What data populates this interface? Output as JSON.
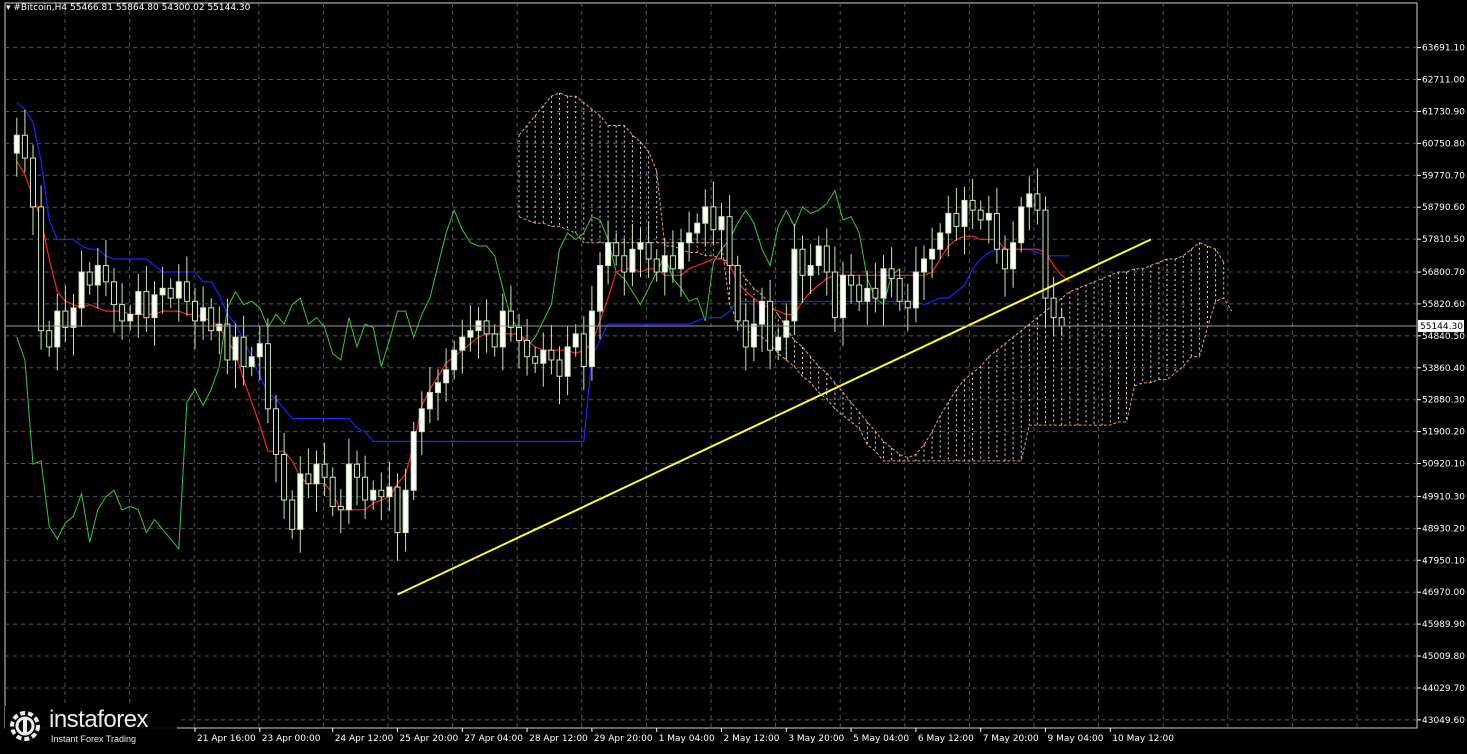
{
  "header": {
    "symbol_text": "#Bitcoin,H4  55466.81 55864.80 54300.02 55144.30"
  },
  "watermark": {
    "name": "instaforex",
    "tagline": "Instant Forex Trading",
    "icon": "instaforex-gear-icon"
  },
  "colors": {
    "background": "#000000",
    "grid": "#4a5a5a",
    "bull_candle": "#ffffff",
    "bear_candle": "#000000",
    "candle_wick": "#cce8b0",
    "tenkan": "#ff2020",
    "kijun": "#2020ff",
    "chikou": "#33cc33",
    "cloud_bull": "#e0e0e0",
    "cloud_bear": "#e8a070",
    "trendline": "#ffff33",
    "axis_text": "#ffffff"
  },
  "chart_data": {
    "type": "candlestick",
    "instrument": "#Bitcoin",
    "timeframe": "H4",
    "ohlc_header": {
      "open": 55466.81,
      "high": 55864.8,
      "low": 54300.02,
      "close": 55144.3
    },
    "current_price": 55144.3,
    "current_price_label": "55144.30",
    "ylim": [
      42800,
      64600
    ],
    "y_ticks": [
      "63691.10",
      "62711.00",
      "61730.90",
      "60750.80",
      "59770.70",
      "58790.60",
      "57810.50",
      "56800.70",
      "55820.60",
      "54840.50",
      "53860.40",
      "52880.30",
      "51900.20",
      "50920.10",
      "49910.30",
      "48930.20",
      "47950.10",
      "46970.00",
      "45989.90",
      "45009.80",
      "44029.70",
      "43049.60"
    ],
    "x_ticks": [
      {
        "label": "21 Apr 16:00",
        "index": 0
      },
      {
        "label": "23 Apr 00:00",
        "index": 8
      },
      {
        "label": "24 Apr 12:00",
        "index": 17
      },
      {
        "label": "25 Apr 20:00",
        "index": 25
      },
      {
        "label": "27 Apr 04:00",
        "index": 33
      },
      {
        "label": "28 Apr 12:00",
        "index": 41
      },
      {
        "label": "29 Apr 20:00",
        "index": 49
      },
      {
        "label": "1 May 04:00",
        "index": 57
      },
      {
        "label": "2 May 12:00",
        "index": 65
      },
      {
        "label": "3 May 20:00",
        "index": 73
      },
      {
        "label": "5 May 04:00",
        "index": 81
      },
      {
        "label": "6 May 12:00",
        "index": 89
      },
      {
        "label": "7 May 20:00",
        "index": 97
      },
      {
        "label": "9 May 04:00",
        "index": 105
      },
      {
        "label": "10 May 12:00",
        "index": 113
      }
    ],
    "candles_close": [
      60450,
      61000,
      60300,
      58800,
      55000,
      54500,
      55600,
      55100,
      55700,
      56800,
      56400,
      57000,
      56500,
      55800,
      55300,
      55500,
      56200,
      55400,
      56100,
      56300,
      56000,
      56500,
      55900,
      55300,
      55700,
      55000,
      55200,
      54100,
      54800,
      53900,
      54200,
      54600,
      52600,
      51200,
      49800,
      48900,
      50600,
      50300,
      50900,
      50500,
      49600,
      49500,
      50900,
      50500,
      49800,
      50100,
      49900,
      50200,
      48800,
      50100,
      51900,
      52600,
      53100,
      53400,
      53800,
      54400,
      54800,
      55000,
      55300,
      54900,
      54500,
      55600,
      55100,
      54700,
      54200,
      54000,
      54400,
      54100,
      53600,
      54500,
      54900,
      53900,
      55600,
      57000,
      57700,
      57300,
      56800,
      57500,
      57700,
      57200,
      56800,
      57300,
      56900,
      57700,
      58000,
      58300,
      58800,
      58100,
      58500,
      57000,
      55300,
      54500,
      55200,
      55900,
      54400,
      54800,
      55300,
      57500,
      56700,
      57000,
      57600,
      56800,
      55400,
      56700,
      56400,
      55900,
      56300,
      56000,
      56900,
      56600,
      55900,
      55700,
      56800,
      57200,
      57500,
      58000,
      58600,
      58200,
      59000,
      58700,
      58400,
      58600,
      57500,
      56900,
      57700,
      58800,
      59200,
      58700,
      56000,
      55400,
      55144
    ],
    "tenkan_sen": [
      60200,
      59800,
      59100,
      58400,
      57200,
      56200,
      55900,
      55800,
      55700,
      55800,
      55700,
      55600,
      55600,
      55600,
      55500,
      55500,
      55500,
      55500,
      55600,
      55600,
      55600,
      55500,
      55500,
      55400,
      55300,
      55100,
      54700,
      54300,
      53500,
      52800,
      52100,
      51300,
      51300,
      51300,
      51000,
      50500,
      50300,
      50300,
      50300,
      50000,
      49500,
      49500,
      49500,
      49500,
      49700,
      49800,
      49900,
      50300,
      50600,
      51500,
      52700,
      53200,
      53600,
      54000,
      54200,
      54400,
      54600,
      54800,
      54900,
      54900,
      54900,
      54900,
      54900,
      54700,
      54500,
      54400,
      54400,
      54400,
      54400,
      54300,
      54400,
      54600,
      55300,
      56000,
      56800,
      56900,
      56900,
      56800,
      56900,
      56900,
      56700,
      56700,
      56700,
      56900,
      57000,
      57100,
      57200,
      57200,
      57000,
      56500,
      56200,
      56000,
      55800,
      55700,
      55600,
      55500,
      55500,
      55900,
      56200,
      56400,
      56600,
      56700,
      56700,
      56700,
      56700,
      56700,
      56700,
      56700,
      56700,
      56700,
      56700,
      56700,
      56700,
      56800,
      57200,
      57600,
      57800,
      57900,
      57900,
      57800,
      57800,
      57800,
      57500,
      57500,
      57500,
      57500,
      57500,
      57400,
      57000,
      56700,
      56500
    ],
    "kijun_sen": [
      62000,
      61800,
      61400,
      60200,
      58400,
      57800,
      57800,
      57800,
      57600,
      57500,
      57500,
      57300,
      57200,
      57200,
      57200,
      57200,
      57200,
      57000,
      56800,
      56800,
      56800,
      56800,
      56800,
      56500,
      56500,
      56100,
      55500,
      55200,
      54700,
      54200,
      53600,
      53100,
      52900,
      52600,
      52300,
      52300,
      52300,
      52300,
      52300,
      52300,
      52300,
      52300,
      52000,
      51900,
      51600,
      51600,
      51600,
      51600,
      51600,
      51600,
      51600,
      51600,
      51600,
      51600,
      51600,
      51600,
      51600,
      51600,
      51600,
      51600,
      51600,
      51600,
      51600,
      51600,
      51600,
      51600,
      51600,
      51600,
      51600,
      51600,
      51600,
      54200,
      54700,
      55200,
      55200,
      55200,
      55200,
      55200,
      55200,
      55200,
      55200,
      55200,
      55200,
      55200,
      55300,
      55400,
      55400,
      55400,
      55600,
      55900,
      55900,
      55900,
      55900,
      55900,
      55900,
      55900,
      55900,
      55900,
      55900,
      55900,
      55900,
      55900,
      55900,
      55900,
      55900,
      55900,
      55900,
      55900,
      55900,
      55900,
      55900,
      55900,
      55800,
      55900,
      56000,
      56000,
      56200,
      56400,
      56900,
      57200,
      57400,
      57500,
      57500,
      57500,
      57500,
      57500,
      57400,
      57300,
      57300,
      57300,
      57300
    ],
    "chikou_span": [
      54800,
      54100,
      50900,
      51000,
      49000,
      48600,
      49100,
      49300,
      50000,
      48500,
      49500,
      49900,
      50100,
      49500,
      49600,
      49500,
      48800,
      49200,
      48900,
      48600,
      48300,
      52800,
      53200,
      52700,
      53200,
      53900,
      55700,
      56200,
      55800,
      55900,
      55700,
      55100,
      55500,
      55200,
      55800,
      56000,
      55200,
      55400,
      55100,
      54300,
      54100,
      55400,
      54500,
      55200,
      55100,
      53900,
      54700,
      55600,
      55600,
      54800,
      55500,
      56000,
      57000,
      58000,
      58700,
      58100,
      57700,
      57600,
      57600,
      57300,
      56300,
      55400,
      55000,
      54500,
      54800,
      55300,
      55800,
      57500,
      58000,
      57800,
      58000,
      58500,
      58400,
      57800,
      56800,
      56600,
      56200,
      55800,
      56300,
      56800,
      57300,
      56600,
      56300,
      55900,
      56000,
      55300,
      57100,
      57500,
      57800,
      58300,
      58700,
      58300,
      57500,
      57000,
      58200,
      58700,
      58200,
      58800,
      58600,
      58700,
      58900,
      59300,
      58400,
      58500,
      58000,
      56600,
      56000,
      55800,
      56700,
      56900
    ],
    "senkou_a": [
      61000,
      61300,
      61600,
      61900,
      62200,
      62300,
      62200,
      62200,
      62000,
      61800,
      61600,
      61300,
      61300,
      61300,
      61000,
      60800,
      60500,
      59900,
      57600,
      57600,
      57500,
      57400,
      57400,
      57300,
      57300,
      57200,
      57100,
      56900,
      56600,
      56300,
      56100,
      55800,
      55500,
      55100,
      54700,
      54500,
      54200,
      53900,
      53700,
      53400,
      53100,
      52800,
      52500,
      52200,
      51900,
      51600,
      51400,
      51200,
      51100,
      51200,
      51500,
      51900,
      52400,
      52800,
      53200,
      53500,
      53700,
      53900,
      54200,
      54400,
      54600,
      54800,
      55000,
      55200,
      55400,
      55600,
      55800,
      56000,
      56200,
      56300,
      56400,
      56500,
      56600,
      56700,
      56800,
      56800,
      56900,
      56900,
      57000,
      57100,
      57200,
      57200,
      57300,
      57500,
      57700,
      57600,
      57500,
      57100
    ],
    "senkou_b": [
      58500,
      58400,
      58300,
      58300,
      58200,
      58200,
      58100,
      58000,
      57700,
      57700,
      57700,
      57700,
      57700,
      57700,
      57700,
      57700,
      57700,
      57700,
      57700,
      57700,
      57700,
      57700,
      57700,
      57700,
      57700,
      57700,
      55800,
      55300,
      55000,
      54900,
      54800,
      54600,
      54300,
      54100,
      53900,
      53600,
      53400,
      53100,
      52900,
      52600,
      52400,
      52200,
      52000,
      51500,
      51300,
      51000,
      51000,
      51000,
      51000,
      51000,
      51000,
      51000,
      51000,
      51000,
      51000,
      51000,
      51000,
      51000,
      51000,
      51000,
      51000,
      51000,
      51000,
      52100,
      52100,
      52100,
      52100,
      52100,
      52100,
      52100,
      52100,
      52100,
      52100,
      52100,
      52200,
      52200,
      53300,
      53400,
      53400,
      53500,
      53500,
      53700,
      53900,
      54200,
      54200,
      55100,
      55900,
      56000,
      55600
    ],
    "trendline": {
      "from": {
        "index": 25,
        "price": 46900
      },
      "to": {
        "index": 118,
        "price": 57800
      }
    }
  }
}
